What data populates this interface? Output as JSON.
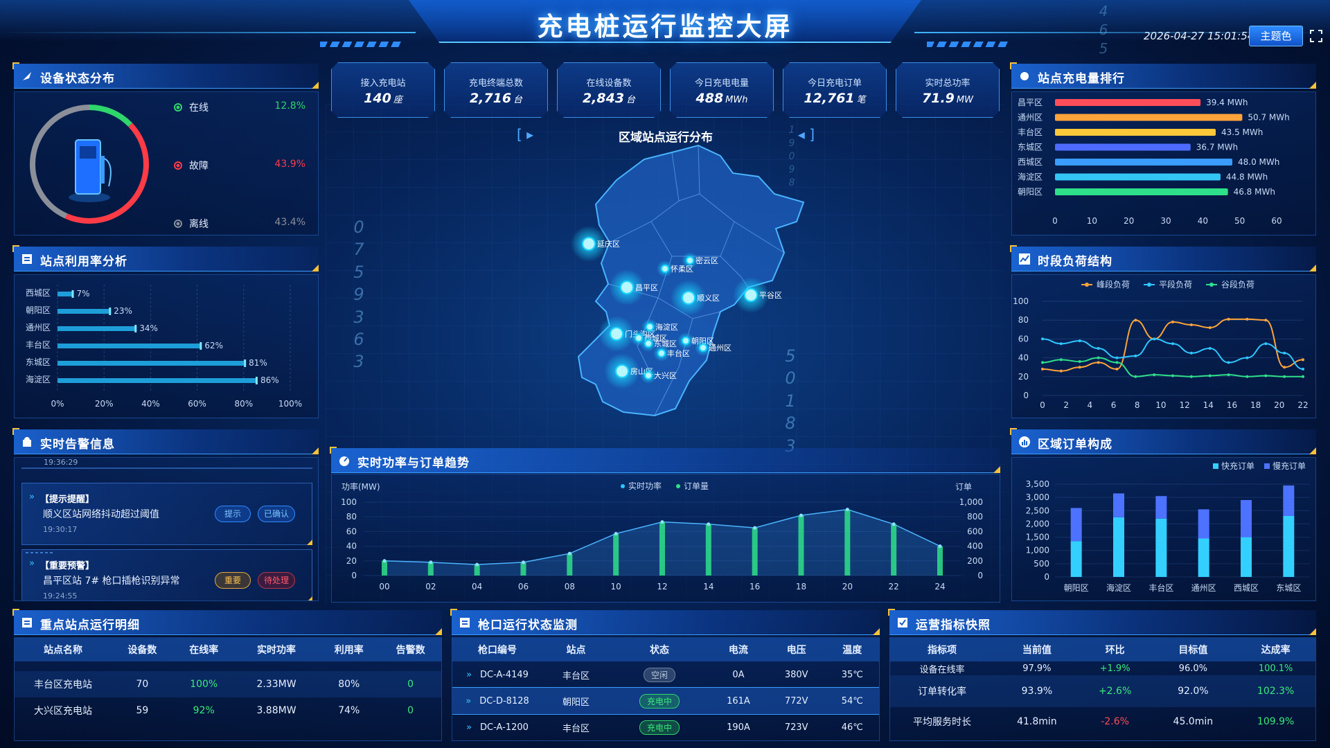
{
  "header": {
    "title": "充电桩运行监控大屏",
    "datetime": "2026-04-27 15:01:54",
    "theme_button": "主题色"
  },
  "stats": [
    {
      "label": "接入充电站",
      "value": "140",
      "unit": "座"
    },
    {
      "label": "充电终端总数",
      "value": "2,716",
      "unit": "台"
    },
    {
      "label": "在线设备数",
      "value": "2,843",
      "unit": "台"
    },
    {
      "label": "今日充电电量",
      "value": "488",
      "unit": "MWh"
    },
    {
      "label": "今日充电订单",
      "value": "12,761",
      "unit": "笔"
    },
    {
      "label": "实时总功率",
      "value": "71.9",
      "unit": "MW"
    }
  ],
  "device_status": {
    "title": "设备状态分布",
    "items": [
      {
        "label": "在线",
        "pct": "12.8%",
        "color": "#2fd66b"
      },
      {
        "label": "故障",
        "pct": "43.9%",
        "color": "#ff3b46"
      },
      {
        "label": "离线",
        "pct": "43.4%",
        "color": "#8a8f99"
      }
    ]
  },
  "utilization": {
    "title": "站点利用率分析",
    "chart_data": {
      "type": "bar",
      "categories": [
        "西城区",
        "朝阳区",
        "通州区",
        "丰台区",
        "东城区",
        "海淀区"
      ],
      "values": [
        7,
        23,
        34,
        62,
        81,
        86
      ],
      "value_labels": [
        "7%",
        "23%",
        "34%",
        "62%",
        "81%",
        "86%"
      ],
      "xlim": [
        0,
        100
      ],
      "xticks": [
        "0%",
        "20%",
        "40%",
        "60%",
        "80%",
        "100%"
      ]
    }
  },
  "alerts": {
    "title": "实时告警信息",
    "top_time": "19:36:29",
    "items": [
      {
        "tag": "【提示提醒】",
        "text": "顺义区站网络抖动超过阈值",
        "time": "19:30:17",
        "level": "提示",
        "status": "已确认"
      },
      {
        "tag": "【重要预警】",
        "text": "昌平区站 7# 枪口插枪识别异常",
        "time": "19:24:55",
        "level": "重要",
        "status": "待处理"
      }
    ]
  },
  "map": {
    "title": "区域站点运行分布",
    "labels": [
      "延庆区",
      "密云区",
      "怀柔区",
      "昌平区",
      "顺义区",
      "平谷区",
      "门头沟区",
      "海淀区",
      "西城区",
      "东城区",
      "朝阳区",
      "丰台区",
      "通州区",
      "房山区",
      "大兴区"
    ]
  },
  "floating_digits": {
    "left": [
      "0",
      "7",
      "5",
      "9",
      "3",
      "6",
      "3"
    ],
    "right": [
      "5",
      "0",
      "1",
      "8",
      "3"
    ],
    "top": [
      "4",
      "6",
      "5"
    ],
    "top_small": [
      "1",
      "9",
      "0",
      "9",
      "8"
    ]
  },
  "trend": {
    "title": "实时功率与订单趋势",
    "chart_data": {
      "type": "bar+area",
      "x": [
        "00",
        "02",
        "04",
        "06",
        "08",
        "10",
        "12",
        "14",
        "16",
        "18",
        "20",
        "22",
        "24"
      ],
      "series": [
        {
          "name": "实时功率",
          "axis": "left",
          "values": [
            20,
            18,
            15,
            18,
            30,
            57,
            73,
            70,
            65,
            82,
            90,
            70,
            40
          ]
        },
        {
          "name": "订单量",
          "axis": "right",
          "values": [
            200,
            180,
            150,
            180,
            300,
            570,
            730,
            700,
            650,
            820,
            900,
            700,
            400
          ]
        }
      ],
      "ylabel_left": "功率(MW)",
      "ylabel_right": "订单",
      "ylim_left": [
        0,
        100
      ],
      "ylim_right": [
        0,
        1000
      ],
      "yticks_left": [
        "0",
        "20",
        "40",
        "60",
        "80",
        "100"
      ],
      "yticks_right": [
        "0",
        "200",
        "400",
        "600",
        "800",
        "1,000"
      ]
    }
  },
  "ranking": {
    "title": "站点充电量排行",
    "chart_data": {
      "type": "bar",
      "categories": [
        "昌平区",
        "通州区",
        "丰台区",
        "东城区",
        "西城区",
        "海淀区",
        "朝阳区"
      ],
      "values": [
        39.4,
        50.7,
        43.5,
        36.7,
        48.0,
        44.8,
        46.8
      ],
      "value_labels": [
        "39.4 MWh",
        "50.7 MWh",
        "43.5 MWh",
        "36.7 MWh",
        "48.0 MWh",
        "44.8 MWh",
        "46.8 MWh"
      ],
      "colors": [
        "#ff4d5a",
        "#ffa43a",
        "#ffc83a",
        "#4d6bff",
        "#3a9cff",
        "#33c6f5",
        "#2fe08a"
      ],
      "xlim": [
        0,
        60
      ],
      "xticks": [
        "0",
        "10",
        "20",
        "30",
        "40",
        "50",
        "60"
      ]
    }
  },
  "load": {
    "title": "时段负荷结构",
    "chart_data": {
      "type": "line",
      "x": [
        "0",
        "2",
        "4",
        "6",
        "8",
        "10",
        "12",
        "14",
        "16",
        "18",
        "20",
        "22"
      ],
      "series": [
        {
          "name": "峰段负荷",
          "color": "#ffa43a",
          "values": [
            28,
            26,
            30,
            35,
            28,
            80,
            60,
            78,
            75,
            72,
            81,
            81,
            80,
            30,
            38
          ]
        },
        {
          "name": "平段负荷",
          "color": "#2ec6ff",
          "values": [
            60,
            55,
            58,
            50,
            40,
            42,
            60,
            55,
            45,
            50,
            35,
            40,
            55,
            45,
            28
          ]
        },
        {
          "name": "谷段负荷",
          "color": "#2fe08a",
          "values": [
            35,
            38,
            36,
            40,
            35,
            20,
            22,
            21,
            20,
            21,
            22,
            20,
            21,
            20,
            20
          ]
        }
      ],
      "ylim": [
        0,
        100
      ],
      "yticks": [
        "0",
        "20",
        "40",
        "60",
        "80",
        "100"
      ]
    }
  },
  "orders": {
    "title": "区域订单构成",
    "chart_data": {
      "type": "stacked-bar",
      "categories": [
        "朝阳区",
        "海淀区",
        "丰台区",
        "通州区",
        "西城区",
        "东城区"
      ],
      "series": [
        {
          "name": "快充订单",
          "color": "#33d0ff",
          "values": [
            1350,
            2250,
            2200,
            1450,
            1500,
            2300
          ]
        },
        {
          "name": "慢充订单",
          "color": "#4d72ff",
          "values": [
            1250,
            900,
            850,
            1100,
            1400,
            1150
          ]
        }
      ],
      "ylim": [
        0,
        3500
      ],
      "yticks": [
        "0",
        "500",
        "1,000",
        "1,500",
        "2,000",
        "2,500",
        "3,000",
        "3,500"
      ]
    }
  },
  "stations": {
    "title": "重点站点运行明细",
    "columns": [
      "站点名称",
      "设备数",
      "在线率",
      "实时功率",
      "利用率",
      "告警数"
    ],
    "rows": [
      [
        "丰台区充电站",
        "70",
        "100%",
        "2.33MW",
        "80%",
        "0"
      ],
      [
        "大兴区充电站",
        "59",
        "92%",
        "3.88MW",
        "74%",
        "0"
      ]
    ]
  },
  "guns": {
    "title": "枪口运行状态监测",
    "columns": [
      "枪口编号",
      "站点",
      "状态",
      "电流",
      "电压",
      "温度"
    ],
    "rows": [
      [
        "DC-A-4149",
        "丰台区",
        "空闲",
        "0A",
        "380V",
        "35℃"
      ],
      [
        "DC-D-8128",
        "朝阳区",
        "充电中",
        "161A",
        "772V",
        "54℃"
      ],
      [
        "DC-A-1200",
        "丰台区",
        "充电中",
        "190A",
        "723V",
        "46℃"
      ]
    ]
  },
  "ops": {
    "title": "运营指标快照",
    "columns": [
      "指标项",
      "当前值",
      "环比",
      "目标值",
      "达成率"
    ],
    "rows": [
      [
        "设备在线率",
        "97.9%",
        "+1.9%",
        "96.0%",
        "100.1%"
      ],
      [
        "订单转化率",
        "93.9%",
        "+2.6%",
        "92.0%",
        "102.3%"
      ],
      [
        "平均服务时长",
        "41.8min",
        "-2.6%",
        "45.0min",
        "109.9%"
      ]
    ]
  }
}
